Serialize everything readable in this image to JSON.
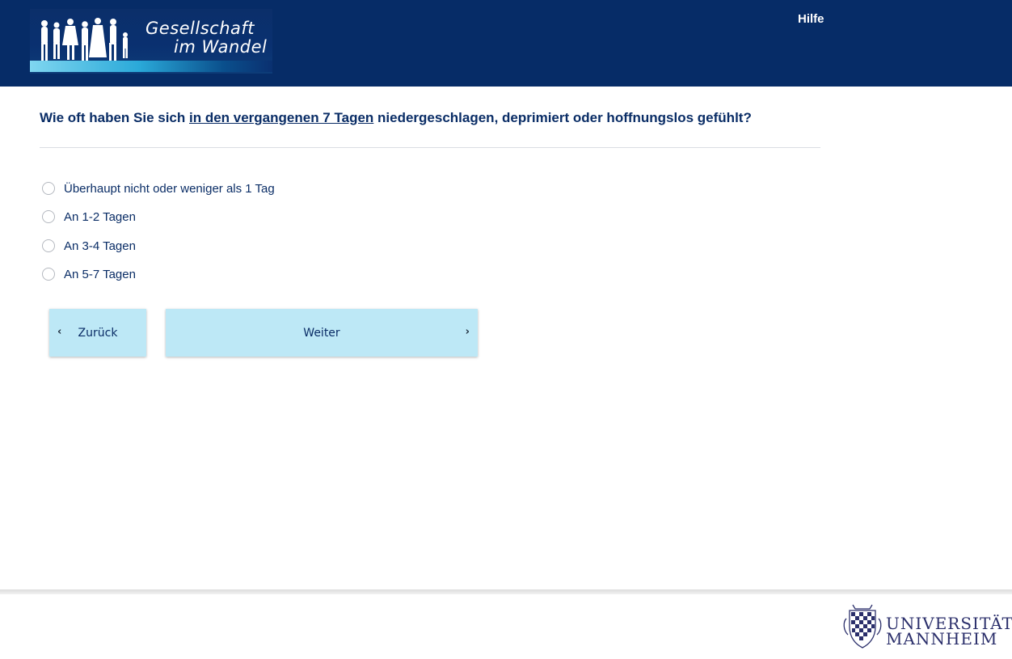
{
  "header": {
    "logo": {
      "line1": "Gesellschaft",
      "line2": "im Wandel"
    },
    "help_label": "Hilfe",
    "background_color": "#062c67"
  },
  "question": {
    "prefix": "Wie oft haben Sie sich ",
    "emphasis": "in den vergangenen 7 Tagen",
    "suffix": " niedergeschlagen, deprimiert oder hoffnungslos gefühlt?"
  },
  "options": [
    {
      "label": "Überhaupt nicht oder weniger als 1 Tag",
      "selected": false
    },
    {
      "label": "An 1-2 Tagen",
      "selected": false
    },
    {
      "label": "An 3-4 Tagen",
      "selected": false
    },
    {
      "label": "An 5-7 Tagen",
      "selected": false
    }
  ],
  "navigation": {
    "back_label": "Zurück",
    "next_label": "Weiter",
    "button_color": "#bde8f6"
  },
  "footer": {
    "university_line1": "UNIVERSITÄT",
    "university_line2": "MANNHEIM"
  }
}
